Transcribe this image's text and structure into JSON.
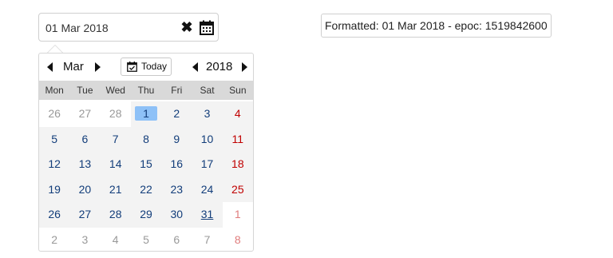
{
  "date_input": {
    "value": "01 Mar 2018",
    "clear_icon": "close-icon",
    "calendar_icon": "calendar-icon"
  },
  "formatted_output": "Formatted: 01 Mar 2018 - epoc: 1519842600",
  "calendar": {
    "month_label": "Mar",
    "year_label": "2018",
    "today_label": "Today",
    "weekdays": [
      "Mon",
      "Tue",
      "Wed",
      "Thu",
      "Fri",
      "Sat",
      "Sun"
    ],
    "selected_day": "1",
    "weeks": [
      [
        "26",
        "27",
        "28",
        "1",
        "2",
        "3",
        "4"
      ],
      [
        "5",
        "6",
        "7",
        "8",
        "9",
        "10",
        "11"
      ],
      [
        "12",
        "13",
        "14",
        "15",
        "16",
        "17",
        "18"
      ],
      [
        "19",
        "20",
        "21",
        "22",
        "23",
        "24",
        "25"
      ],
      [
        "26",
        "27",
        "28",
        "29",
        "30",
        "31",
        "1"
      ],
      [
        "2",
        "3",
        "4",
        "5",
        "6",
        "7",
        "8"
      ]
    ],
    "colors": {
      "current_month_text": "#123d7a",
      "sunday_text": "#c00000",
      "outside_text": "#999999",
      "selected_bg": "#8ec1f7",
      "header_bg": "#d9d9d9"
    }
  }
}
